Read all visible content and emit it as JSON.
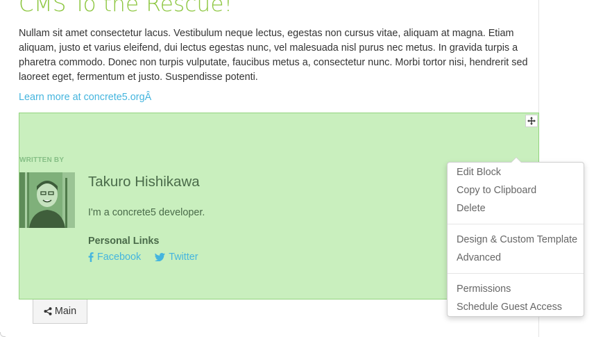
{
  "page": {
    "heading": "CMS To the Rescue!",
    "body_text": "Nullam sit amet consectetur lacus. Vestibulum neque lectus, egestas non cursus vitae, aliquam at magna. Etiam aliquam, justo et varius eleifend, dui lectus egestas nunc, vel malesuada nisl purus nec metus. In gravida turpis a pharetra commodo. Donec non turpis vulputate, faucibus metus a, consectetur nunc. Morbi tortor nisi, hendrerit sed laoreet eget, fermentum et justo. Suspendisse potenti.",
    "learn_more_link": "Learn more at concrete5.orgÂ"
  },
  "author_block": {
    "written_by": "WRITTEN BY",
    "name": "Takuro Hishikawa",
    "bio": "I'm a concrete5 developer.",
    "links_heading": "Personal Links",
    "links": [
      {
        "label": "Facebook",
        "icon": "facebook-icon"
      },
      {
        "label": "Twitter",
        "icon": "twitter-icon"
      }
    ],
    "move_icon": "move-arrows-icon",
    "highlight_color": "#c9efbe"
  },
  "area_tab": {
    "label": "Main",
    "icon": "share-icon"
  },
  "block_menu": {
    "groups": [
      [
        "Edit Block",
        "Copy to Clipboard",
        "Delete"
      ],
      [
        "Design & Custom Template",
        "Advanced"
      ],
      [
        "Permissions",
        "Schedule Guest Access"
      ]
    ]
  },
  "colors": {
    "accent_green": "#8cc63f",
    "link_blue": "#45b5de"
  }
}
